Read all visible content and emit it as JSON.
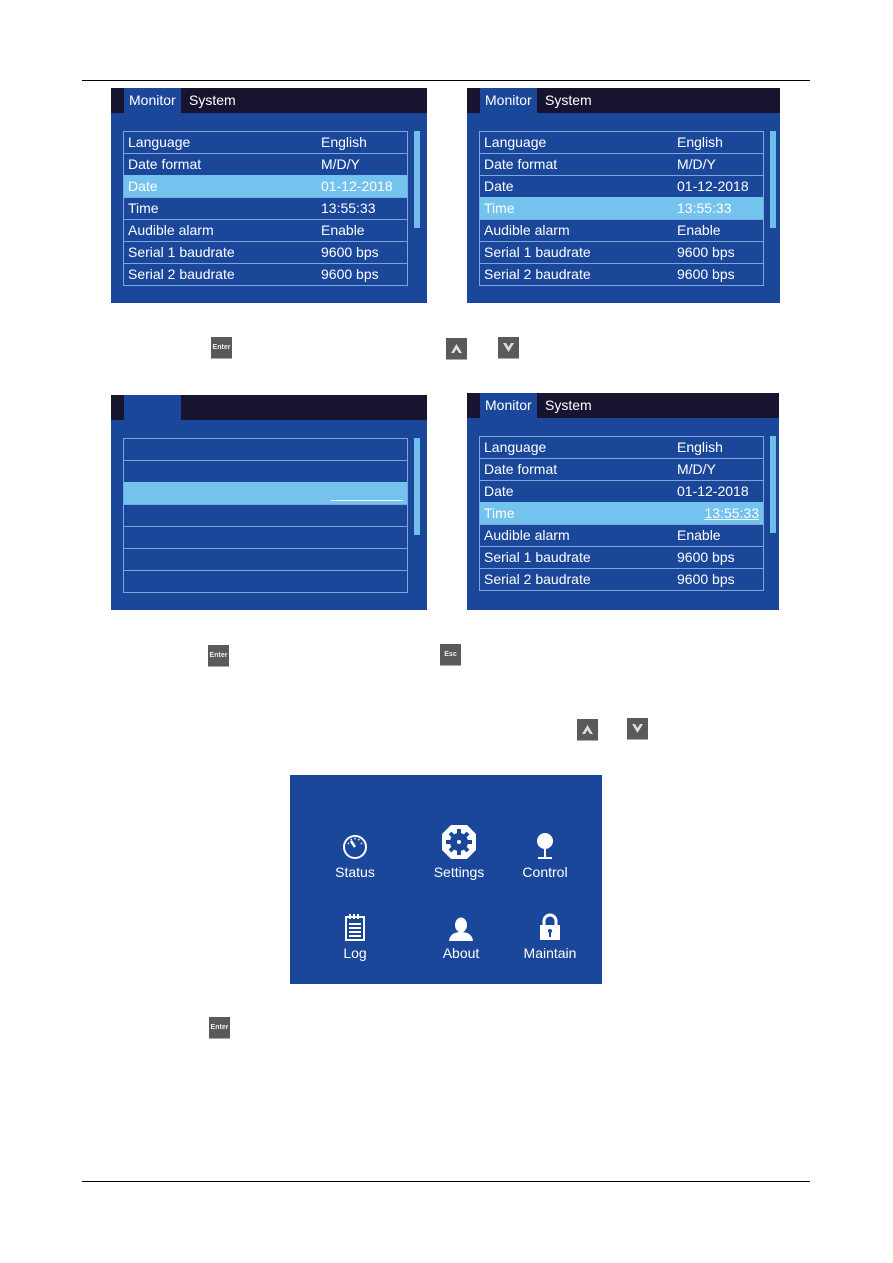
{
  "screens": [
    {
      "tabs": [
        {
          "label": "Monitor",
          "active": true
        },
        {
          "label": "System",
          "active": false
        }
      ],
      "rows": [
        {
          "label": "Language",
          "value": "English"
        },
        {
          "label": "Date format",
          "value": "M/D/Y"
        },
        {
          "label": "Date",
          "value": "01-12-2018",
          "selected": true
        },
        {
          "label": "Time",
          "value": "13:55:33"
        },
        {
          "label": "Audible alarm",
          "value": "Enable"
        },
        {
          "label": "Serial 1 baudrate",
          "value": "9600 bps"
        },
        {
          "label": "Serial 2 baudrate",
          "value": "9600 bps"
        }
      ]
    },
    {
      "tabs": [
        {
          "label": "Monitor",
          "active": true
        },
        {
          "label": "System",
          "active": false
        }
      ],
      "rows": [
        {
          "label": "Language",
          "value": "English"
        },
        {
          "label": "Date format",
          "value": "M/D/Y"
        },
        {
          "label": "Date",
          "value": "01-12-2018"
        },
        {
          "label": "Time",
          "value": "13:55:33",
          "selected": true
        },
        {
          "label": "Audible alarm",
          "value": "Enable"
        },
        {
          "label": "Serial 1 baudrate",
          "value": "9600 bps"
        },
        {
          "label": "Serial 2 baudrate",
          "value": "9600 bps"
        }
      ]
    },
    {
      "tabs": [
        {
          "label": "",
          "active": true
        }
      ],
      "rows": [
        {
          "label": "",
          "value": ""
        },
        {
          "label": "",
          "value": ""
        },
        {
          "label": "",
          "value": "",
          "selected": true,
          "editing": true
        },
        {
          "label": "",
          "value": ""
        },
        {
          "label": "",
          "value": ""
        },
        {
          "label": "",
          "value": ""
        },
        {
          "label": "",
          "value": ""
        }
      ]
    },
    {
      "tabs": [
        {
          "label": "Monitor",
          "active": true
        },
        {
          "label": "System",
          "active": false
        }
      ],
      "rows": [
        {
          "label": "Language",
          "value": "English"
        },
        {
          "label": "Date format",
          "value": "M/D/Y"
        },
        {
          "label": "Date",
          "value": "01-12-2018"
        },
        {
          "label": "Time",
          "value": "13:55:33",
          "selected": true,
          "editing": true
        },
        {
          "label": "Audible alarm",
          "value": "Enable"
        },
        {
          "label": "Serial 1 baudrate",
          "value": "9600 bps"
        },
        {
          "label": "Serial 2 baudrate",
          "value": "9600 bps"
        }
      ]
    }
  ],
  "keys": {
    "enter": "Enter",
    "esc": "Esc",
    "up": "up-arrow",
    "down": "down-arrow"
  },
  "main_menu": {
    "items": [
      {
        "label": "Status",
        "icon": "gauge-icon"
      },
      {
        "label": "Settings",
        "icon": "gear-icon",
        "selected": true
      },
      {
        "label": "Control",
        "icon": "joystick-icon"
      },
      {
        "label": "Log",
        "icon": "notepad-icon"
      },
      {
        "label": "About",
        "icon": "person-icon"
      },
      {
        "label": "Maintain",
        "icon": "padlock-icon"
      }
    ]
  },
  "colors": {
    "screen_bg": "#1b479b",
    "tab_bar": "#17142f",
    "highlight": "#74c2ee",
    "key": "#5a5a5c"
  }
}
